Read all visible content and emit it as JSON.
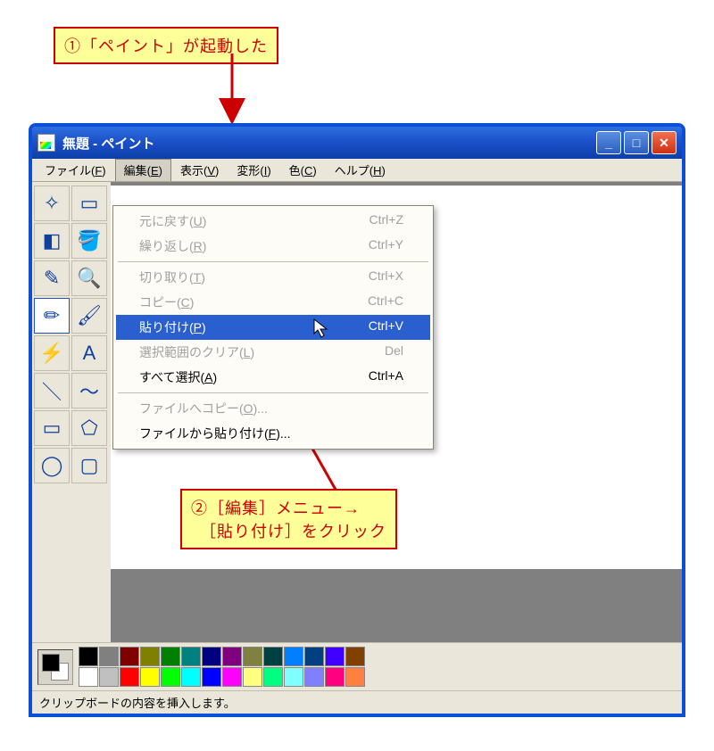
{
  "annotations": {
    "top": "①「ペイント」が起動した",
    "bottom_line1": "②［編集］メニュー→",
    "bottom_line2": "　［貼り付け］をクリック"
  },
  "window": {
    "title": "無題 - ペイント"
  },
  "menubar": [
    {
      "label": "ファイル(F)",
      "open": false
    },
    {
      "label": "編集(E)",
      "open": true
    },
    {
      "label": "表示(V)",
      "open": false
    },
    {
      "label": "変形(I)",
      "open": false
    },
    {
      "label": "色(C)",
      "open": false
    },
    {
      "label": "ヘルプ(H)",
      "open": false
    }
  ],
  "edit_menu": [
    {
      "label": "元に戻す(U)",
      "shortcut": "Ctrl+Z",
      "disabled": true
    },
    {
      "label": "繰り返し(R)",
      "shortcut": "Ctrl+Y",
      "disabled": true
    },
    {
      "sep": true
    },
    {
      "label": "切り取り(T)",
      "shortcut": "Ctrl+X",
      "disabled": true
    },
    {
      "label": "コピー(C)",
      "shortcut": "Ctrl+C",
      "disabled": true
    },
    {
      "label": "貼り付け(P)",
      "shortcut": "Ctrl+V",
      "disabled": false,
      "highlight": true
    },
    {
      "label": "選択範囲のクリア(L)",
      "shortcut": "Del",
      "disabled": true
    },
    {
      "label": "すべて選択(A)",
      "shortcut": "Ctrl+A",
      "disabled": false
    },
    {
      "sep": true
    },
    {
      "label": "ファイルへコピー(O)...",
      "shortcut": "",
      "disabled": true
    },
    {
      "label": "ファイルから貼り付け(F)...",
      "shortcut": "",
      "disabled": false
    }
  ],
  "tools": [
    {
      "name": "free-select-tool",
      "glyph": "✧"
    },
    {
      "name": "rect-select-tool",
      "glyph": "▭"
    },
    {
      "name": "eraser-tool",
      "glyph": "◧"
    },
    {
      "name": "fill-tool",
      "glyph": "🪣"
    },
    {
      "name": "picker-tool",
      "glyph": "✎"
    },
    {
      "name": "magnifier-tool",
      "glyph": "🔍"
    },
    {
      "name": "pencil-tool",
      "glyph": "✏",
      "selected": true
    },
    {
      "name": "brush-tool",
      "glyph": "🖌"
    },
    {
      "name": "airbrush-tool",
      "glyph": "⚡"
    },
    {
      "name": "text-tool",
      "glyph": "A"
    },
    {
      "name": "line-tool",
      "glyph": "＼"
    },
    {
      "name": "curve-tool",
      "glyph": "〜"
    },
    {
      "name": "rect-tool",
      "glyph": "▭"
    },
    {
      "name": "polygon-tool",
      "glyph": "⬠"
    },
    {
      "name": "ellipse-tool",
      "glyph": "◯"
    },
    {
      "name": "rounded-rect-tool",
      "glyph": "▢"
    }
  ],
  "palette": {
    "row1": [
      "#000000",
      "#808080",
      "#800000",
      "#808000",
      "#008000",
      "#008080",
      "#000080",
      "#800080",
      "#808040",
      "#004040",
      "#0080ff",
      "#004080",
      "#4000ff",
      "#804000"
    ],
    "row2": [
      "#ffffff",
      "#c0c0c0",
      "#ff0000",
      "#ffff00",
      "#00ff00",
      "#00ffff",
      "#0000ff",
      "#ff00ff",
      "#ffff80",
      "#00ff80",
      "#80ffff",
      "#8080ff",
      "#ff0080",
      "#ff8040"
    ]
  },
  "statusbar": {
    "text": "クリップボードの内容を挿入します。"
  }
}
